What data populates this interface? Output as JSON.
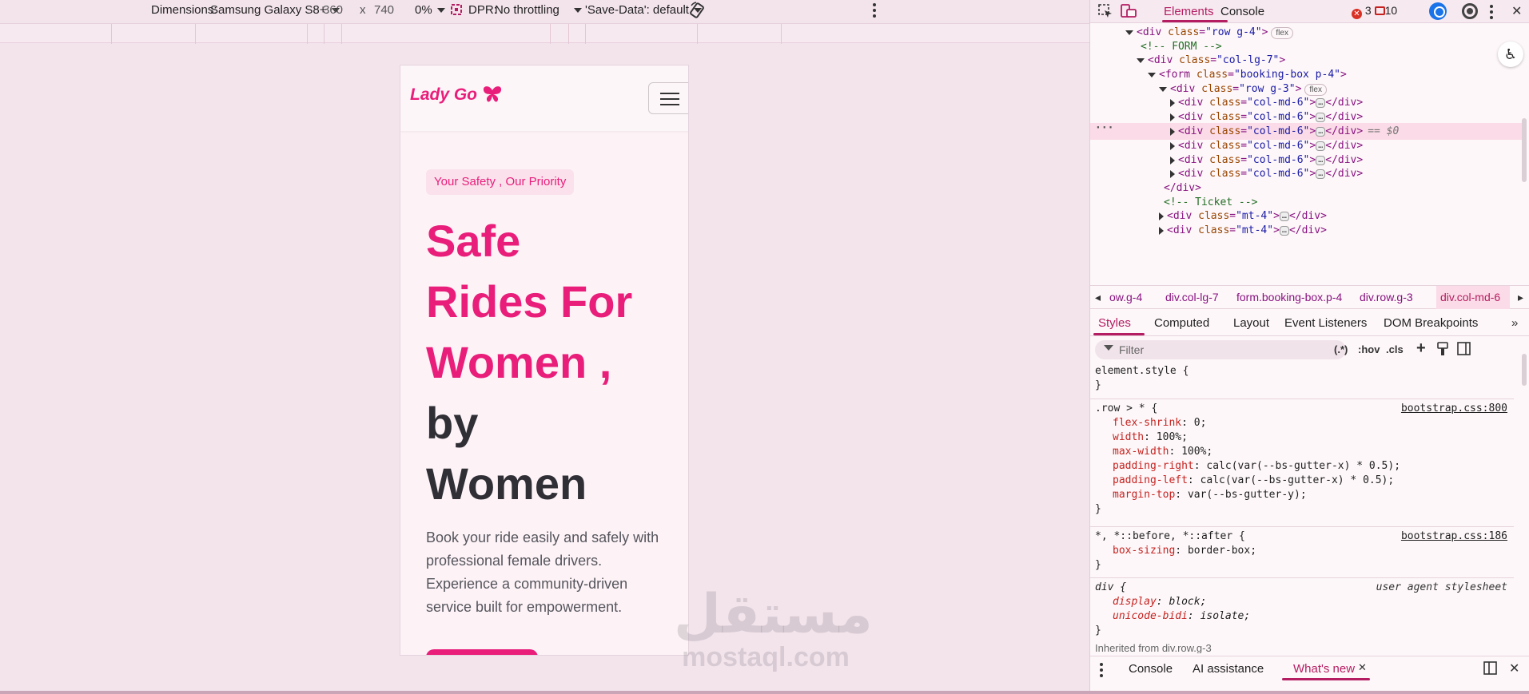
{
  "device_toolbar": {
    "dimensions_label": "Dimensions:",
    "device": "Samsung Galaxy S8+",
    "width": "360",
    "times": "x",
    "height": "740",
    "zoom": "0%",
    "dpr_label": "DPR:",
    "throttling": "No throttling",
    "save_data": "'Save-Data': default"
  },
  "page": {
    "brand": "Lady Go",
    "badge": "Your Safety , Our Priority",
    "hero": {
      "line1": "Safe",
      "line2": "Rides For",
      "line3": "Women ,",
      "line4": "by",
      "line5": "Women"
    },
    "description": "Book your ride easily and safely with professional female drivers. Experience a community-driven service built for empowerment.",
    "colors": {
      "accent": "#e91e7a",
      "heading_dark": "#2f2f35",
      "background": "#fdf3f7"
    }
  },
  "watermark": {
    "arabic": "مستقل",
    "latin": "mostaql.com"
  },
  "devtools": {
    "tabs": {
      "elements": "Elements",
      "console": "Console"
    },
    "errors": "3",
    "warnings": "10",
    "tree": {
      "row_g4": {
        "tag": "<div",
        "attr": "class",
        "value": "\"row g-4\"",
        "close": ">",
        "badge": "flex"
      },
      "comment_form": "<!-- FORM -->",
      "col_lg7": {
        "tag": "<div",
        "attr": "class",
        "value": "\"col-lg-7\"",
        "close": ">"
      },
      "form": {
        "tag": "<form",
        "attr": "class",
        "value": "\"booking-box p-4\"",
        "close": ">"
      },
      "row_g3": {
        "tag": "<div",
        "attr": "class",
        "value": "\"row g-3\"",
        "close": ">",
        "badge": "flex"
      },
      "col_md6": {
        "tag": "<div",
        "attr": "class",
        "value": "\"col-md-6\"",
        "close": ">",
        "ellipsis": "…",
        "end": "</div>"
      },
      "selected_suffix": "== $0",
      "close_div": "</div>",
      "comment_ticket": "<!-- Ticket -->",
      "mt4": {
        "tag": "<div",
        "attr": "class",
        "value": "\"mt-4\"",
        "close": ">",
        "ellipsis": "…",
        "end": "</div>"
      }
    },
    "breadcrumbs": [
      "ow.g-4",
      "div.col-lg-7",
      "form.booking-box.p-4",
      "div.row.g-3",
      "div.col-md-6"
    ],
    "style_tabs": [
      "Styles",
      "Computed",
      "Layout",
      "Event Listeners",
      "DOM Breakpoints"
    ],
    "filter_placeholder": "Filter",
    "filter_tools": {
      "regex": "(.*)",
      "hov": ":hov",
      "cls": ".cls"
    },
    "rules": {
      "element_style": {
        "selector": "element.style {",
        "close": "}"
      },
      "row_child": {
        "selector": ".row > * {",
        "source": "bootstrap.css:800",
        "props": [
          {
            "name": "flex-shrink",
            "value": "0;"
          },
          {
            "name": "width",
            "value": "100%;"
          },
          {
            "name": "max-width",
            "value": "100%;"
          },
          {
            "name": "padding-right",
            "value": "calc(var(--bs-gutter-x) * 0.5);"
          },
          {
            "name": "padding-left",
            "value": "calc(var(--bs-gutter-x) * 0.5);"
          },
          {
            "name": "margin-top",
            "value": "var(--bs-gutter-y);"
          }
        ],
        "close": "}"
      },
      "universal": {
        "selector": "*, *::before, *::after {",
        "source": "bootstrap.css:186",
        "props": [
          {
            "name": "box-sizing",
            "value": "border-box;"
          }
        ],
        "close": "}"
      },
      "div_ua": {
        "selector": "div {",
        "source": "user agent stylesheet",
        "props": [
          {
            "name": "display",
            "value": "block;"
          },
          {
            "name": "unicode-bidi",
            "value": "isolate;"
          }
        ],
        "close": "}"
      },
      "inherited": "Inherited from div.row.g-3"
    },
    "drawer": {
      "console": "Console",
      "ai": "AI assistance",
      "whats_new": "What's new"
    }
  }
}
